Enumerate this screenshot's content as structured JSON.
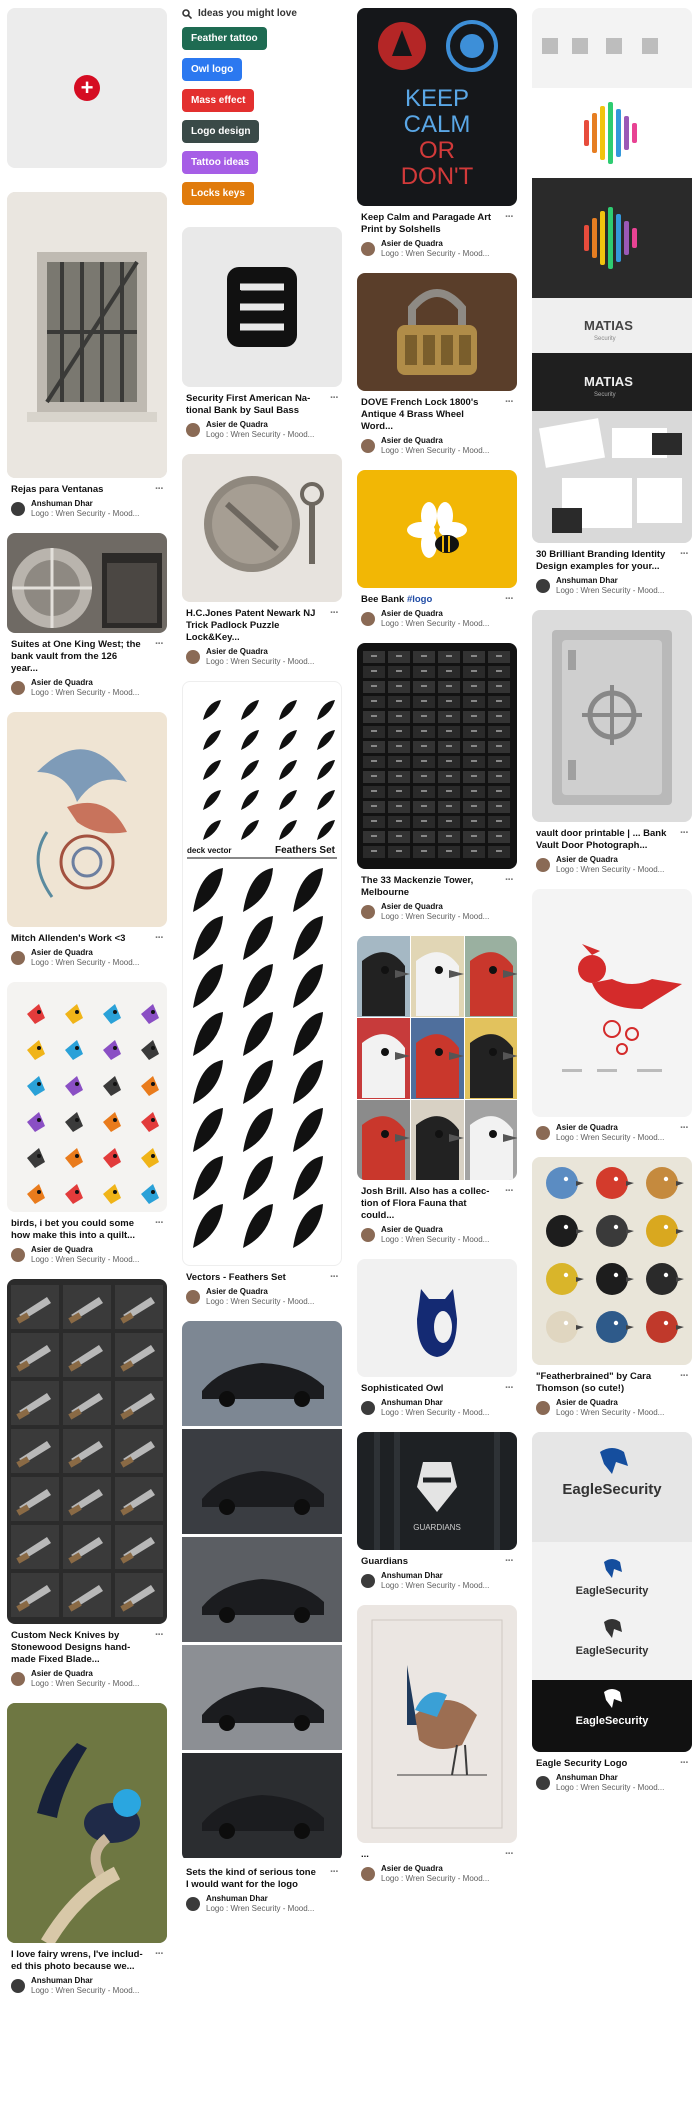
{
  "ideas": {
    "heading": "Ideas you might love",
    "chips": [
      {
        "label": "Feather tattoo",
        "color": "#1e6b52"
      },
      {
        "label": "Owl logo",
        "color": "#2b78f0"
      },
      {
        "label": "Mass effect",
        "color": "#e3302f"
      },
      {
        "label": "Logo design",
        "color": "#3a4a48"
      },
      {
        "label": "Tattoo ideas",
        "color": "#a65ee6"
      },
      {
        "label": "Locks keys",
        "color": "#e07b0c"
      }
    ]
  },
  "pins": [
    {
      "title": "Rejas para Ventanas",
      "user": "Anshuman Dhar",
      "board": "Logo : Wren Security - Mood..."
    },
    {
      "title": "Suites at One King West; the bank vault from the 126 year...",
      "user": "Asier de Quadra",
      "board": "Logo : Wren Security - Mood..."
    },
    {
      "title": "Mitch Allenden's Work <3",
      "user": "Asier de Quadra",
      "board": "Logo : Wren Security - Mood..."
    },
    {
      "title": "birds, i bet you could some how make this into a quilt...",
      "user": "Asier de Quadra",
      "board": "Logo : Wren Security - Mood..."
    },
    {
      "title": "Custom Neck Knives by Stonewood Designs hand-made Fixed Blade...",
      "user": "Asier de Quadra",
      "board": "Logo : Wren Security - Mood..."
    },
    {
      "title": "I love fairy wrens, I've includ-ed this photo because we...",
      "user": "Anshuman Dhar",
      "board": "Logo : Wren Security - Mood..."
    },
    {
      "title": "Security First American Na-tional Bank by Saul Bass",
      "user": "Asier de Quadra",
      "board": "Logo : Wren Security - Mood..."
    },
    {
      "title": "H.C.Jones Patent Newark NJ Trick Padlock Puzzle Lock&Key...",
      "user": "Asier de Quadra",
      "board": "Logo : Wren Security - Mood..."
    },
    {
      "title": "Vectors - Feathers Set",
      "user": "Asier de Quadra",
      "board": "Logo : Wren Security - Mood..."
    },
    {
      "title": "Sets the kind of serious tone I would want for the logo",
      "user": "Anshuman Dhar",
      "board": "Logo : Wren Security - Mood..."
    },
    {
      "title": "Keep Calm and Paragade Art Print by Solshells",
      "user": "Asier de Quadra",
      "board": "Logo : Wren Security - Mood..."
    },
    {
      "title": "DOVE French Lock 1800's Antique 4 Brass Wheel Word...",
      "user": "Asier de Quadra",
      "board": "Logo : Wren Security - Mood..."
    },
    {
      "title": "Bee Bank ",
      "tag": "#logo",
      "user": "Asier de Quadra",
      "board": "Logo : Wren Security - Mood..."
    },
    {
      "title": "The 33 Mackenzie Tower, Melbourne",
      "user": "Asier de Quadra",
      "board": "Logo : Wren Security - Mood..."
    },
    {
      "title": "Josh Brill. Also has a collec-tion of Flora Fauna that could...",
      "user": "Asier de Quadra",
      "board": "Logo : Wren Security - Mood..."
    },
    {
      "title": "Sophisticated Owl",
      "user": "Anshuman Dhar",
      "board": "Logo : Wren Security - Mood..."
    },
    {
      "title": "Guardians",
      "user": "Anshuman Dhar",
      "board": "Logo : Wren Security - Mood..."
    },
    {
      "title": "...",
      "user": "Asier de Quadra",
      "board": "Logo : Wren Security - Mood..."
    },
    {
      "title": "30 Brilliant Branding Identity Design examples for your...",
      "user": "Anshuman Dhar",
      "board": "Logo : Wren Security - Mood..."
    },
    {
      "title": "vault door printable | ... Bank Vault Door Photograph...",
      "user": "Asier de Quadra",
      "board": "Logo : Wren Security - Mood..."
    },
    {
      "title": "",
      "user": "Asier de Quadra",
      "board": "Logo : Wren Security - Mood..."
    },
    {
      "title": "\"Featherbrained\" by Cara Thomson (so cute!)",
      "user": "Asier de Quadra",
      "board": "Logo : Wren Security - Mood..."
    },
    {
      "title": "Eagle Security Logo",
      "user": "Anshuman Dhar",
      "board": "Logo : Wren Security - Mood..."
    }
  ],
  "image_text": {
    "keep_calm": [
      "KEEP",
      "CALM",
      "OR",
      "DON'T"
    ],
    "matias": "MATIAS",
    "matias_sub": "Security",
    "feathers_set": "Feathers Set",
    "feathers_brand": "deck vector",
    "eagle": "EagleSecurity",
    "guardians": "GUARDIANS"
  },
  "more_label": "···",
  "colors": {
    "accent_red": "#d50c22",
    "text_muted": "#5f5f5f"
  }
}
